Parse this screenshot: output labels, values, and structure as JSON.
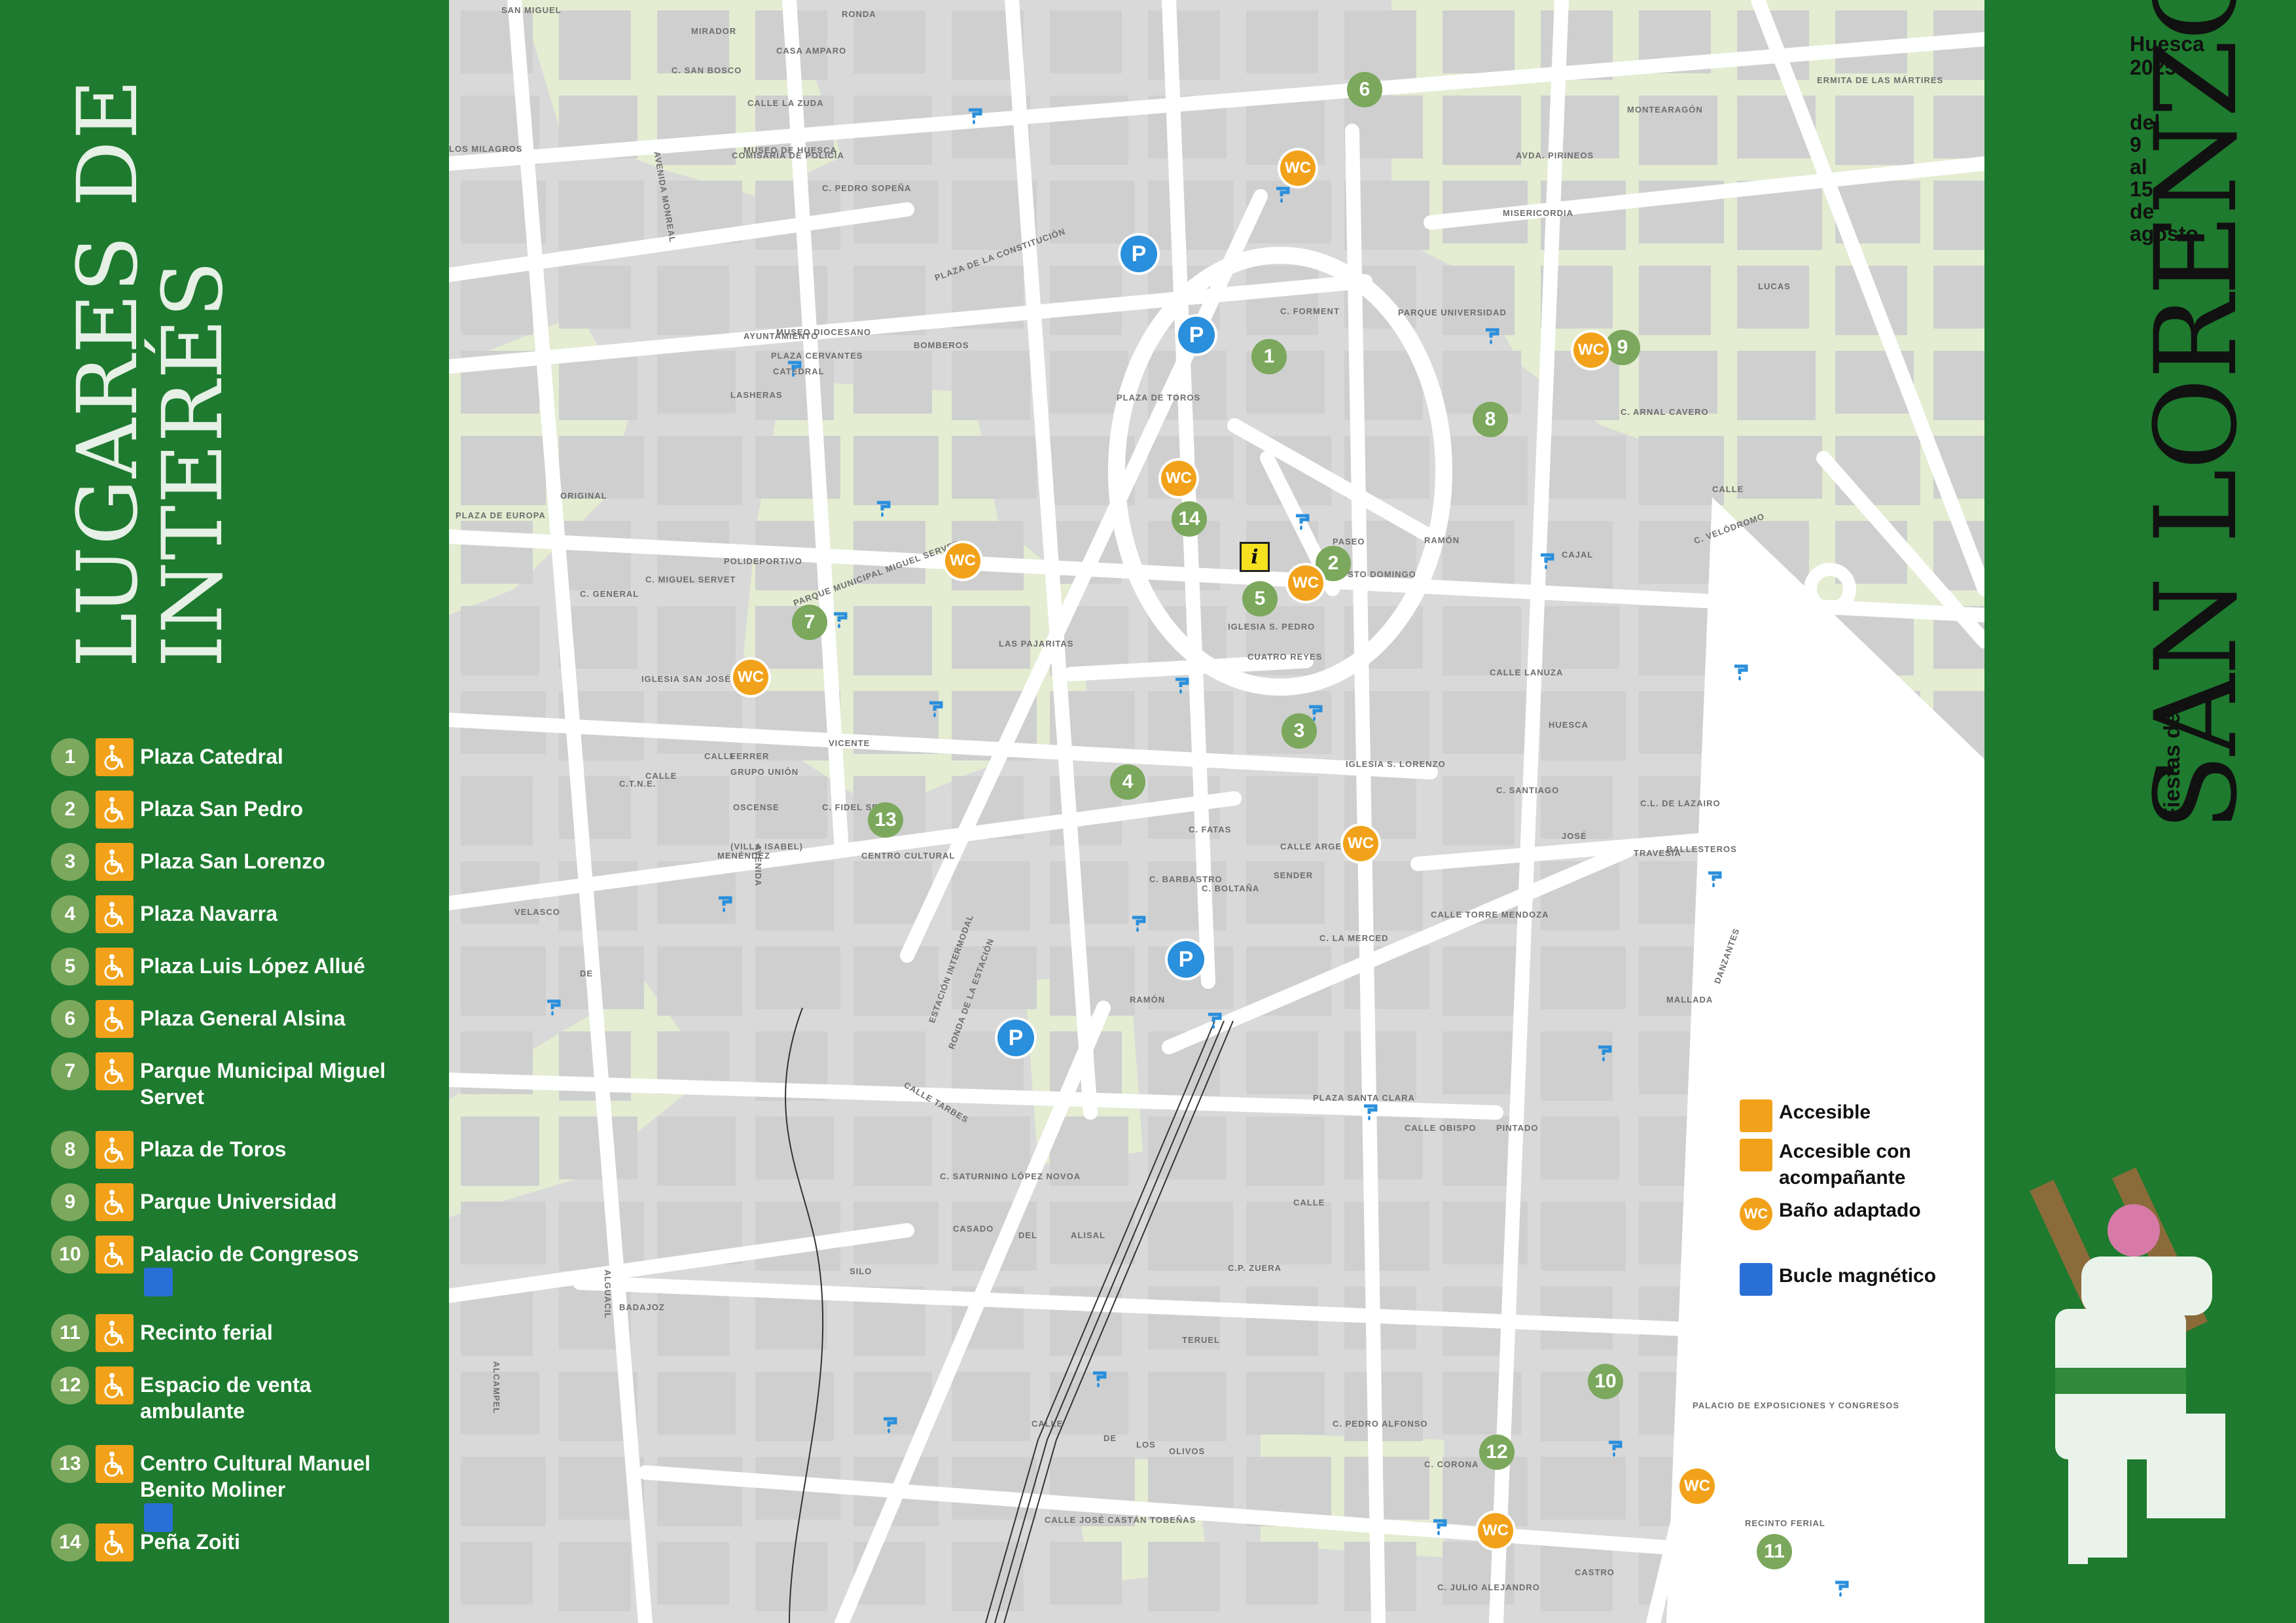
{
  "title": {
    "line1": "LUGARES DE",
    "line2": "INTERÉS"
  },
  "pois": [
    {
      "num": "1",
      "name": "Plaza Catedral",
      "loop": false
    },
    {
      "num": "2",
      "name": "Plaza San Pedro",
      "loop": false
    },
    {
      "num": "3",
      "name": "Plaza San Lorenzo",
      "loop": false
    },
    {
      "num": "4",
      "name": "Plaza Navarra",
      "loop": false
    },
    {
      "num": "5",
      "name": "Plaza Luis López Allué",
      "loop": false
    },
    {
      "num": "6",
      "name": "Plaza General Alsina",
      "loop": false
    },
    {
      "num": "7",
      "name": "Parque Municipal Miguel Servet",
      "loop": false
    },
    {
      "num": "8",
      "name": "Plaza de Toros",
      "loop": false
    },
    {
      "num": "9",
      "name": "Parque Universidad",
      "loop": false
    },
    {
      "num": "10",
      "name": "Palacio de Congresos",
      "loop": true
    },
    {
      "num": "11",
      "name": "Recinto ferial",
      "loop": false
    },
    {
      "num": "12",
      "name": "Espacio de venta ambulante",
      "loop": false
    },
    {
      "num": "13",
      "name": "Centro Cultural Manuel Benito Moliner",
      "loop": true
    },
    {
      "num": "14",
      "name": "Peña Zoiti",
      "loop": false
    }
  ],
  "legend": [
    {
      "icon": "accessible-icon",
      "label": "Accesible"
    },
    {
      "icon": "accessible-companion-icon",
      "label": "Accesible con acompañante"
    },
    {
      "icon": "wc-icon",
      "label": "Baño adaptado"
    },
    {
      "icon": "hearing-loop-icon",
      "label": "Bucle magnético"
    }
  ],
  "event": {
    "name": "SAN LORENZO",
    "prefix": "Fiestas de",
    "city_year": "Huesca 2025",
    "city": "Huesca",
    "year": "2025",
    "dates": [
      "del",
      "9",
      "al",
      "15",
      "de",
      "agosto"
    ]
  },
  "map": {
    "wc_label": "WC",
    "parking_label": "P",
    "info_label": "i",
    "streets": [
      "SAN MIGUEL",
      "MIRADOR",
      "RONDA",
      "C. SAN BOSCO",
      "AVENIDA MONREAL",
      "CALLE LA ZUDA",
      "CASA AMPARO",
      "MUSEO DE HUESCA",
      "PARQUE UNIVERSIDAD",
      "PLAZA DE LA CONSTITUCIÓN",
      "BOMBEROS",
      "PLAZA DE TOROS",
      "CATEDRAL",
      "MUSEO DIOCESANO",
      "AYUNTAMIENTO",
      "C. ARNAL CAVERO",
      "CALLE",
      "PASEO",
      "RAMÓN",
      "CAJAL",
      "C. VELÓDROMO",
      "IGLESIA STO DOMINGO",
      "PARQUE MUNICIPAL MIGUEL SERVET",
      "LAS PAJARITAS",
      "C. MIGUEL SERVET",
      "PLAZA DE EUROPA",
      "CALLE",
      "FERRER",
      "VICENTE",
      "CALLE",
      "GRUPO UNIÓN",
      "OSCENSE",
      "C. FIDEL SERAL",
      "CENTRO CULTURAL",
      "(VILLA ISABEL)",
      "VELASCO",
      "DE",
      "PLAZA SANTA CLARA",
      "CALLE OBISPO",
      "PINTADO",
      "CALLE TARBES",
      "C. SATURNINO LÓPEZ NOVOA",
      "CASADO",
      "DEL",
      "ALISAL",
      "C.P. ZUERA",
      "TERUEL",
      "CALLE",
      "DE",
      "LOS",
      "OLIVOS",
      "C. PEDRO ALFONSO",
      "C. CORONA",
      "RECINTO FERIAL",
      "PALACIO DE EXPOSICIONES Y CONGRESOS",
      "CALLE JOSÉ CASTÁN TOBEÑAS",
      "C. JULIO ALEJANDRO",
      "CASTRO",
      "BADAJOZ",
      "ALGUACIL",
      "ALCAMPEL",
      "SILO",
      "ESTACIÓN INTERMODAL",
      "RONDA DE LA ESTACIÓN",
      "IGLESIA S. PEDRO",
      "CUATRO REYES",
      "IGLESIA S. LORENZO",
      "CALLE TORRE MENDOZA",
      "C. LA MERCED",
      "C. BOLTAÑA",
      "C. FATAS",
      "CALLE ARGENSOLA",
      "C. BARBASTRO",
      "ERMITA DE LAS MÁRTIRES",
      "MISERICORDIA",
      "C. FORMENT",
      "PLAZA CERVANTES",
      "LASHERAS",
      "COMISARÍA DE POLICÍA",
      "C. PEDRO SOPEÑA",
      "POLIDEPORTIVO",
      "IGLESIA SAN JOSÉ",
      "C.T.N.E.",
      "AVENIDA",
      "DANZANTES",
      "BALLESTEROS",
      "TRAVESÍA",
      "C.L. DE LAZAIRO",
      "C. SANTIAGO",
      "CALLE LANUZA",
      "LOS MILAGROS",
      "C. GENERAL",
      "ORIGINAL",
      "MENÉNDEZ",
      "AVDA. PIRINEOS",
      "MONTEARAGÓN",
      "LUCAS",
      "MALLADA",
      "HUESCA",
      "JOSÉ",
      "RAMÓN",
      "SENDER",
      "CALLE"
    ]
  }
}
